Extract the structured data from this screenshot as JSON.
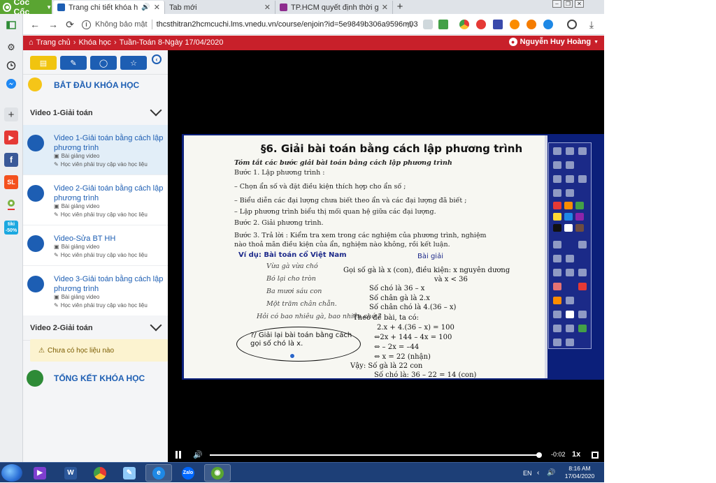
{
  "browser": {
    "brand": "Cốc Cốc",
    "tabs": [
      {
        "title": "Trang chi tiết khóa học: C",
        "active": true,
        "favicon_color": "#1d5eb3",
        "audio": true
      },
      {
        "title": "Tab mới",
        "active": false,
        "favicon_color": "#dfe3e8"
      },
      {
        "title": "TP.HCM quyết định thời gian",
        "active": false,
        "favicon_color": "#8e2c8e"
      }
    ],
    "security_text": "Không bảo mật",
    "url": "thcsthitran2hcmcuchi.lms.vnedu.vn/course/enjoin?id=5e9849b306a9596m03"
  },
  "rail": {
    "items": [
      "sidebar-toggle-icon",
      "settings-icon",
      "history-icon",
      "messenger-icon",
      "add-icon",
      "youtube-icon",
      "facebook-icon",
      "shopping-icon",
      "map-icon",
      "tiki-icon"
    ],
    "tiki_badge": "tiki\n-50%",
    "shop_badge": "SL"
  },
  "lms": {
    "breadcrumb": [
      "Trang chủ",
      "Khóa học",
      "Tuần-Toán 8-Ngày 17/04/2020"
    ],
    "user_name": "Nguyễn Huy Hoàng",
    "start_label": "BẮT ĐẦU KHÓA HỌC",
    "end_label": "TỔNG KẾT KHÓA HỌC",
    "sections": [
      {
        "title": "Video 1-Giải toán",
        "lessons": [
          {
            "title": "Video 1-Giải toán bằng cách lập phương trình",
            "type": "Bài giảng video",
            "note": "Học viên phải truy cập vào học liệu",
            "selected": true
          },
          {
            "title": "Video 2-Giải toán bằng cách lập phương trình",
            "type": "Bài giảng video",
            "note": "Học viên phải truy cập vào học liệu",
            "selected": false
          },
          {
            "title": "Video-Sửa BT HH",
            "type": "Bài giảng video",
            "note": "Học viên phải truy cập vào học liệu",
            "selected": false
          },
          {
            "title": "Video 3-Giải toán bằng cách lập phương trình",
            "type": "Bài giảng video",
            "note": "Học viên phải truy cập vào học liệu",
            "selected": false
          }
        ]
      },
      {
        "title": "Video 2-Giải toán",
        "empty_note": "Chưa có học liệu nào"
      }
    ]
  },
  "slide": {
    "title": "§6. Giải bài toán bằng cách lập phương trình",
    "summary_heading": "Tóm tắt các bước giải bài toán bằng cách lập phương trình",
    "steps": [
      "Bước 1. Lập phương trình :",
      "– Chọn ẩn số và đặt điều kiện thích hợp cho ẩn số ;",
      "– Biểu diễn các đại lượng chưa biết theo ẩn và các đại lượng đã biết ;",
      "– Lập phương trình biểu thị mối quan hệ giữa các đại lượng.",
      "Bước 2. Giải phương trình.",
      "Bước 3. Trả lời : Kiểm tra xem trong các nghiệm của phương trình, nghiệm",
      "nào thoả mãn điều kiện của ẩn, nghiệm nào không, rồi kết luận."
    ],
    "example_label": "Ví dụ: Bài toán cổ Việt Nam",
    "solution_label": "Bài giải",
    "poem": [
      "Vừa gà vừa chó",
      "Bó lại cho tròn",
      "Ba mươi sáu con",
      "Một trăm chân chẵn.",
      "Hỏi có bao nhiêu gà, bao nhiêu chó ?"
    ],
    "solution": [
      "Gọi số gà là x (con), điều kiện: x nguyên dương",
      "và x < 36",
      "Số chó là 36 – x",
      "Số chân gà là 2.x",
      "Số chân chó là 4.(36 – x)",
      "Theo đề bài, ta có:",
      "2.x + 4.(36 – x) = 100",
      "⇔2x + 144 – 4x = 100",
      "⇔ – 2x = –44",
      "⇔ x = 22 (nhận)",
      "Vậy: Số gà là 22 con",
      "Số chó là: 36 – 22 = 14 (con)"
    ],
    "handwritten": "?/ Giải lại bài toán bằng cách gọi số chó là x."
  },
  "player": {
    "time": "-0:02",
    "speed": "1x",
    "progress": 0.998
  },
  "taskbar": {
    "lang": "EN",
    "time": "8:16 AM",
    "date": "17/04/2020"
  },
  "colors": {
    "lms_red": "#c8202a",
    "lms_blue": "#1d5eb3",
    "start_yellow": "#f5c518",
    "end_green": "#2e8b37"
  }
}
